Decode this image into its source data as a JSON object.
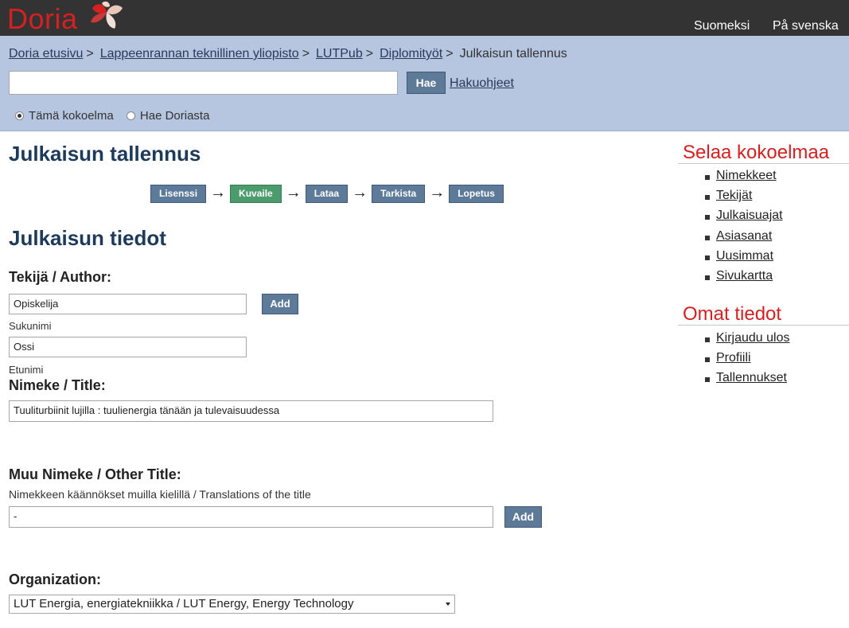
{
  "header": {
    "logo_text": "Doria",
    "languages": [
      "Suomeksi",
      "På svenska"
    ]
  },
  "breadcrumb": {
    "links": [
      "Doria etusivu",
      "Lappeenrannan teknillinen yliopisto",
      "LUTPub",
      "Diplomityöt"
    ],
    "current": "Julkaisun tallennus"
  },
  "search": {
    "value": "",
    "placeholder": "",
    "button_label": "Hae",
    "help_link": "Hakuohjeet",
    "scope_options": [
      "Tämä kokoelma",
      "Hae Doriasta"
    ],
    "scope_selected": "Tämä kokoelma"
  },
  "main": {
    "title": "Julkaisun tallennus",
    "steps": [
      "Lisenssi",
      "Kuvaile",
      "Lataa",
      "Tarkista",
      "Lopetus"
    ],
    "active_step": "Kuvaile",
    "section_title": "Julkaisun tiedot",
    "author": {
      "label": "Tekijä / Author:",
      "surname_value": "Opiskelija",
      "surname_caption": "Sukunimi",
      "firstname_value": "Ossi",
      "firstname_caption": "Etunimi",
      "add_label": "Add"
    },
    "title_field": {
      "label": "Nimeke / Title:",
      "value": "Tuuliturbiinit lujilla : tuulienergia tänään ja tulevaisuudessa"
    },
    "other_title": {
      "label": "Muu Nimeke / Other Title:",
      "hint": "Nimekkeen käännökset muilla kielillä / Translations of the title",
      "value": "-",
      "add_label": "Add"
    },
    "organization": {
      "label": "Organization:",
      "selected": "LUT Energia, energiatekniikka / LUT Energy, Energy Technology"
    }
  },
  "sidebar": {
    "browse_title": "Selaa kokoelmaa",
    "browse_items": [
      "Nimekkeet",
      "Tekijät",
      "Julkaisuajat",
      "Asiasanat",
      "Uusimmat",
      "Sivukartta"
    ],
    "account_title": "Omat tiedot",
    "account_items": [
      "Kirjaudu ulos",
      "Profiili",
      "Tallennukset"
    ]
  },
  "colors": {
    "topbar": "#333333",
    "brand_red": "#d42020",
    "band_blue": "#b6c5e0",
    "button_blue": "#5d7a99",
    "active_green": "#4b9b6c",
    "heading_navy": "#1e3a5a"
  }
}
